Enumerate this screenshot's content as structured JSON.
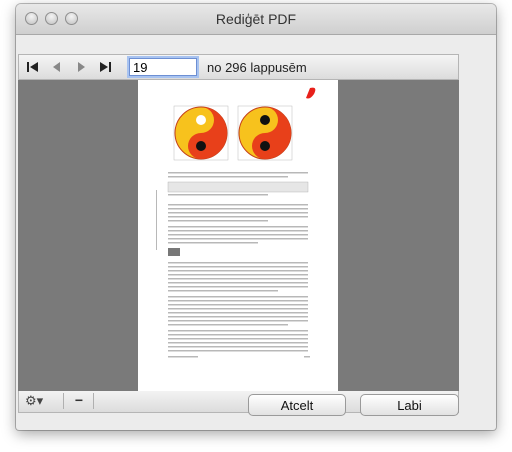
{
  "window": {
    "title": "Rediģēt PDF"
  },
  "navigation": {
    "first_icon": "first-page-icon",
    "prev_icon": "previous-page-icon",
    "next_icon": "next-page-icon",
    "last_icon": "last-page-icon",
    "page_number": "19",
    "page_count_text": "no 296 lappusēm"
  },
  "bottom_bar": {
    "gear_icon": "gear-icon",
    "gear_label": "⚙▾",
    "remove_label": "−"
  },
  "buttons": {
    "cancel": "Atcelt",
    "ok": "Labi"
  },
  "colors": {
    "viewer_background": "#7a7a7a",
    "yin_yang_outer": "#e8401a",
    "yin_yang_inner": "#f7c21d"
  }
}
